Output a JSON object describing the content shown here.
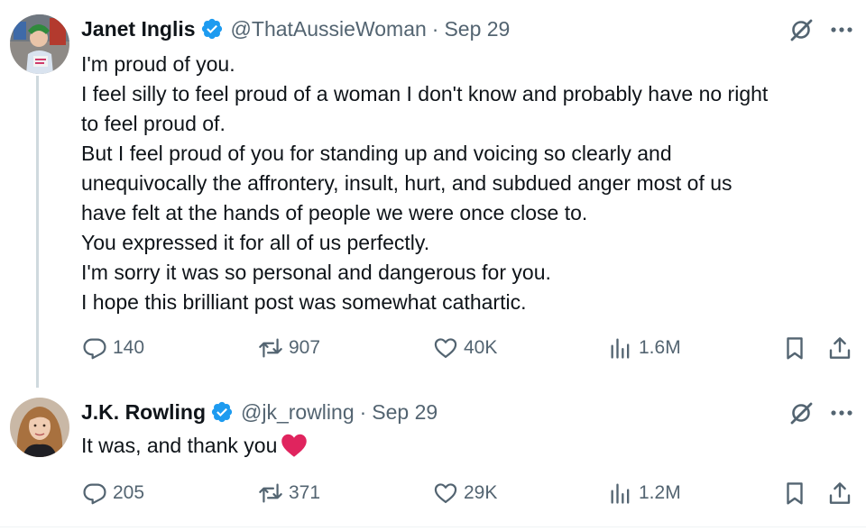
{
  "tweets": [
    {
      "name": "Janet Inglis",
      "handle": "@ThatAussieWoman",
      "separator": "·",
      "date": "Sep 29",
      "lines": [
        "I'm proud of you.",
        "I feel silly to feel proud of a woman I don't know and probably have no right",
        "to feel proud of.",
        "But I feel proud of you for standing up and voicing so clearly and",
        "unequivocally the affrontery, insult, hurt, and subdued anger most of us",
        "have felt at the hands of people we were once close to.",
        "You expressed it for all of us perfectly.",
        "I'm sorry it was so personal and dangerous for you.",
        "I hope this brilliant post was somewhat cathartic."
      ],
      "replies": "140",
      "reposts": "907",
      "likes": "40K",
      "views": "1.6M"
    },
    {
      "name": "J.K. Rowling",
      "handle": "@jk_rowling",
      "separator": "·",
      "date": "Sep 29",
      "lines": [
        "It was, and thank you"
      ],
      "emoji": "red-heart",
      "replies": "205",
      "reposts": "371",
      "likes": "29K",
      "views": "1.2M"
    }
  ],
  "icons": {
    "verified": "verified-badge-icon",
    "grok": "grok-icon",
    "more": "more-icon",
    "reply": "reply-icon",
    "repost": "repost-icon",
    "like": "like-icon",
    "views": "views-icon",
    "bookmark": "bookmark-icon",
    "share": "share-icon"
  },
  "colors": {
    "verified_blue": "#1d9bf0",
    "secondary_text": "#536471",
    "thread_line": "#cfd9de",
    "heart_red": "#e0245e"
  }
}
